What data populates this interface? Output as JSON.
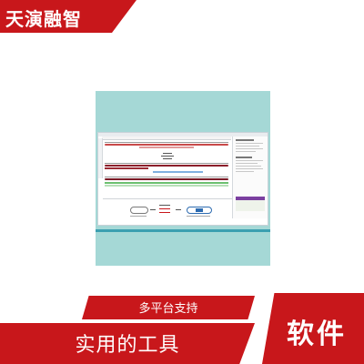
{
  "brand": {
    "name": "天演融智"
  },
  "product": {
    "screenshot_icon": "sequence-editor-screenshot",
    "colors": {
      "panel_bg": "#a5d8d6",
      "accent_line": "#3b9fb0"
    }
  },
  "tags": {
    "platform": "多平台支持",
    "tool": "实用的工具",
    "category": "软件"
  },
  "colors": {
    "brand_red": "#c8171b",
    "text_on_red": "#ffffff"
  }
}
